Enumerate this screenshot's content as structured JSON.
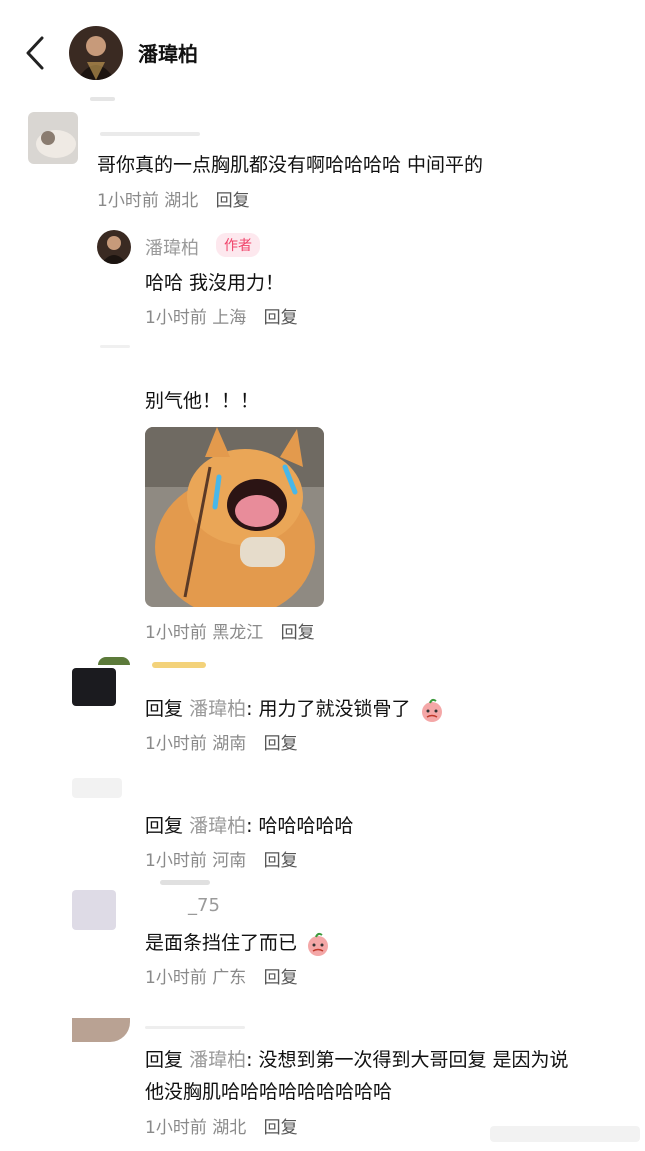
{
  "header": {
    "title": "潘瑋柏"
  },
  "comments": [
    {
      "text": "哥你真的一点胸肌都没有啊哈哈哈哈  中间平的",
      "time": "1小时前",
      "location": "湖北",
      "reply": "回复"
    },
    {
      "user": "潘瑋柏",
      "tag": "作者",
      "text": "哈哈 我沒用力！",
      "time": "1小时前",
      "location": "上海",
      "reply": "回复"
    },
    {
      "text": "别气他！！！",
      "time": "1小时前",
      "location": "黑龙江",
      "reply": "回复"
    },
    {
      "prefix": "回复",
      "mention": "潘瑋柏",
      "text": ": 用力了就没锁骨了",
      "time": "1小时前",
      "location": "湖南",
      "reply": "回复"
    },
    {
      "prefix": "回复",
      "mention": "潘瑋柏",
      "text": ": 哈哈哈哈哈",
      "time": "1小时前",
      "location": "河南",
      "reply": "回复"
    },
    {
      "user": "_75",
      "text": "是面条挡住了而已",
      "time": "1小时前",
      "location": "广东",
      "reply": "回复"
    },
    {
      "prefix": "回复",
      "mention": "潘瑋柏",
      "text": ": 没想到第一次得到大哥回复  是因为说",
      "text2": "他没胸肌哈哈哈哈哈哈哈哈哈",
      "time": "1小时前",
      "location": "湖北",
      "reply": "回复"
    }
  ],
  "icons": {
    "back": "chevron-left-icon",
    "emoji": "crying-peach-emoji-icon",
    "catimage": "crying-cat-photo"
  }
}
